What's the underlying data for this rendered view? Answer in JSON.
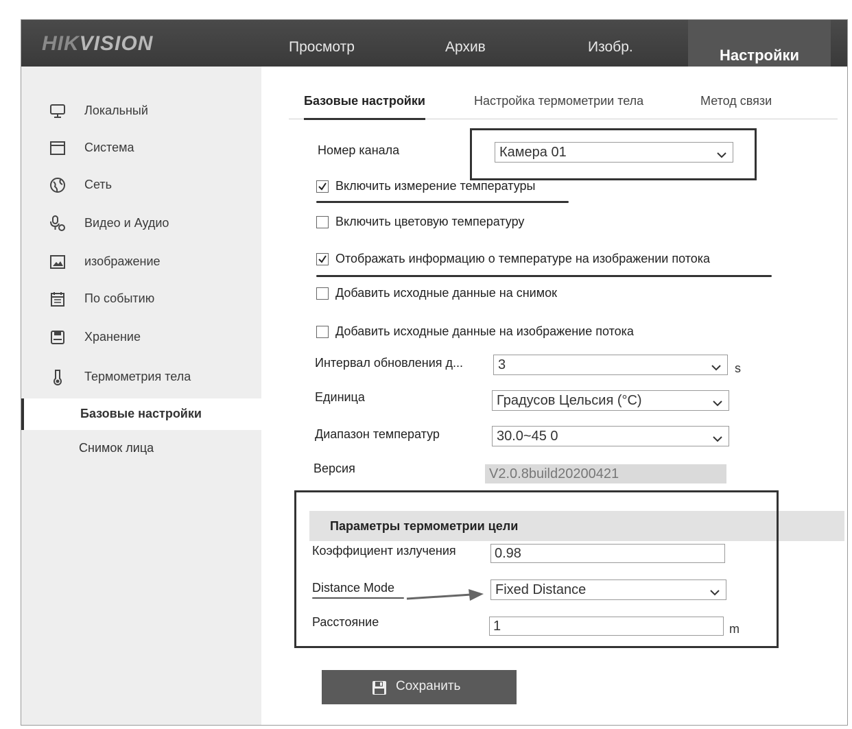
{
  "header": {
    "logo": {
      "part1": "HIK",
      "part2": "VISION"
    },
    "nav": [
      "Просмотр",
      "Архив",
      "Изобр.",
      "Настройки"
    ],
    "active_nav": "Настройки"
  },
  "sidebar": {
    "items": [
      {
        "label": "Локальный",
        "icon": "monitor-icon"
      },
      {
        "label": "Система",
        "icon": "window-icon"
      },
      {
        "label": "Сеть",
        "icon": "globe-icon"
      },
      {
        "label": "Видео и Аудио",
        "icon": "microphone-icon"
      },
      {
        "label": "изображение",
        "icon": "image-icon"
      },
      {
        "label": "По событию",
        "icon": "calendar-icon"
      },
      {
        "label": "Хранение",
        "icon": "storage-icon"
      },
      {
        "label": "Термометрия тела",
        "icon": "thermometer-icon"
      }
    ],
    "subitems": [
      {
        "label": "Базовые настройки",
        "active": true
      },
      {
        "label": "Снимок лица",
        "active": false
      }
    ]
  },
  "tabs": [
    "Базовые настройки",
    "Настройка термометрии тела",
    "Метод связи"
  ],
  "form": {
    "channel_label": "Номер канала",
    "channel_value": "Камера 01",
    "checkboxes": [
      {
        "label": "Включить измерение температуры",
        "checked": true
      },
      {
        "label": "Включить цветовую температуру",
        "checked": false
      },
      {
        "label": "Отображать информацию о температуре на изображении потока",
        "checked": true
      },
      {
        "label": "Добавить исходные данные на снимок",
        "checked": false
      },
      {
        "label": "Добавить исходные данные на изображение потока",
        "checked": false
      }
    ],
    "interval_label": "Интервал обновления д...",
    "interval_value": "3",
    "interval_unit": "s",
    "unit_label": "Единица",
    "unit_value": "Градусов Цельсия (°C)",
    "range_label": "Диапазон температур",
    "range_value": "30.0~45 0",
    "version_label": "Версия",
    "version_value": "V2.0.8build20200421"
  },
  "target": {
    "title": "Параметры термометрии цели",
    "emissivity_label": "Коэффициент излучения",
    "emissivity_value": "0.98",
    "distance_mode_label": "Distance Mode",
    "distance_mode_value": "Fixed Distance",
    "distance_label": "Расстояние",
    "distance_value": "1",
    "distance_unit": "m"
  },
  "save_label": "Сохранить",
  "colors": {
    "header": "#3a3a3a",
    "sidebar": "#eeeeee",
    "section": "#e2e2e2",
    "save": "#5a5a5a"
  }
}
